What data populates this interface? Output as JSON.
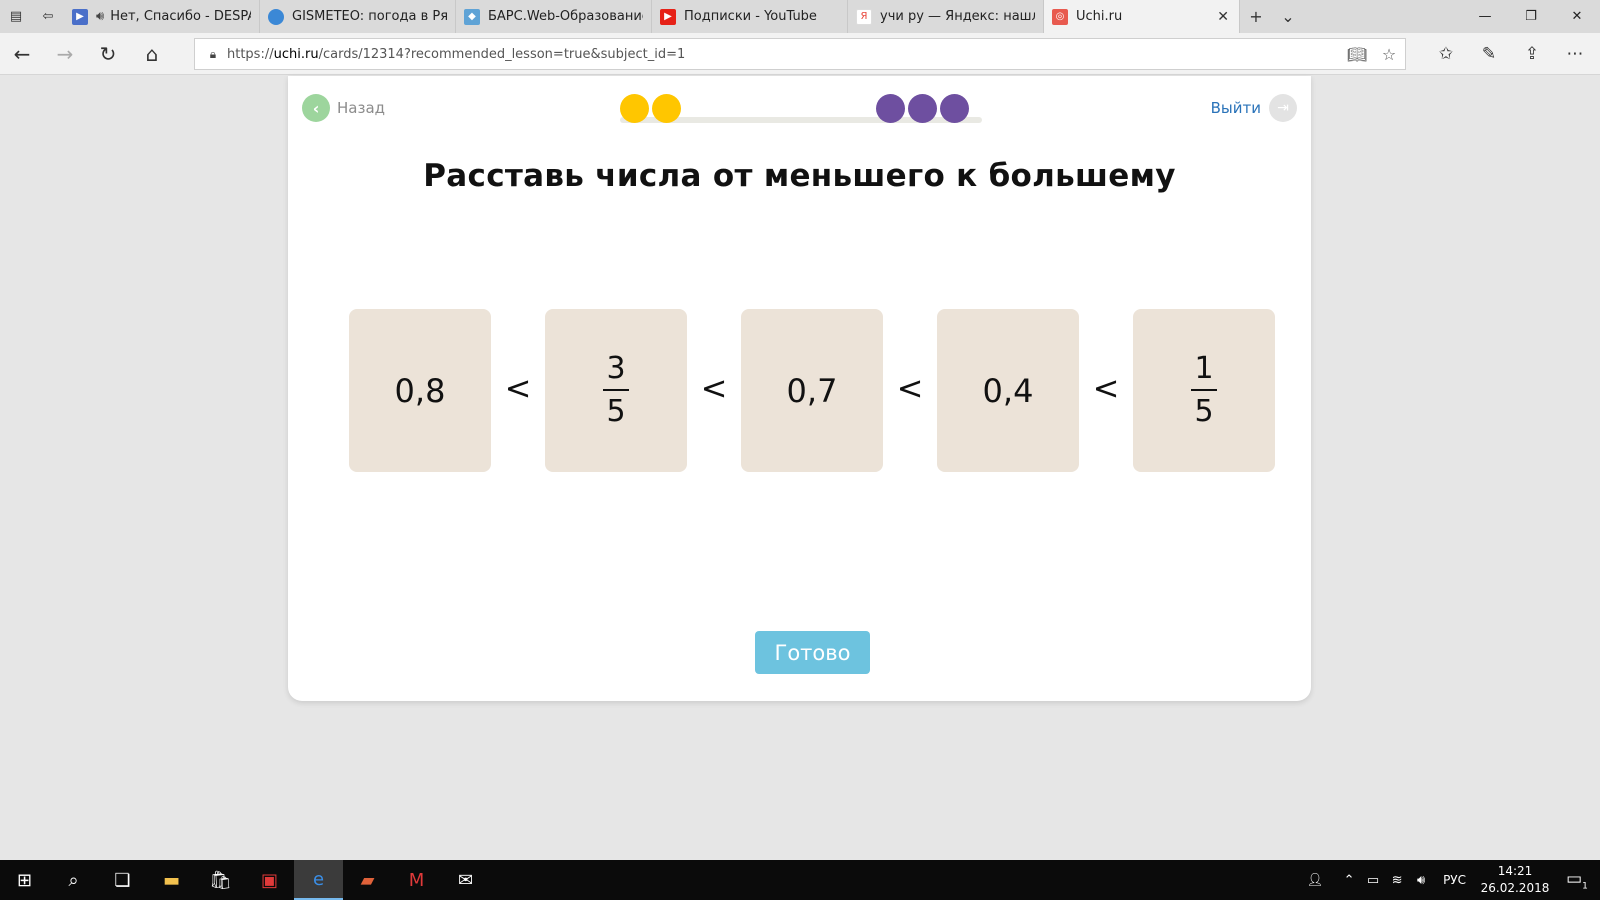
{
  "browser": {
    "tabs": [
      {
        "title": "Нет, Спасибо - DESPAC",
        "favicon": "media-player-icon",
        "favicon_color": "#4a6fc9",
        "extra": "speaker"
      },
      {
        "title": "GISMETEO: погода в Рязан",
        "favicon": "droplet-icon",
        "favicon_color": "#3b88d6"
      },
      {
        "title": "БАРС.Web-Образование",
        "favicon": "bars-icon",
        "favicon_color": "#5fa3d6"
      },
      {
        "title": "Подписки - YouTube",
        "favicon": "youtube-icon",
        "favicon_color": "#e62117"
      },
      {
        "title": "учи ру — Яндекс: нашлось",
        "favicon": "yandex-icon",
        "favicon_color": "#e8463b"
      },
      {
        "title": "Uchi.ru",
        "favicon": "uchi-icon",
        "favicon_color": "#e85a4f",
        "active": true
      }
    ],
    "address": {
      "scheme_prefix": "https://",
      "host": "uchi.ru",
      "path": "/cards/12314?recommended_lesson=true&subject_id=1"
    }
  },
  "lesson": {
    "back_label": "Назад",
    "exit_label": "Выйти",
    "progress": {
      "completed": 2,
      "remaining": 3,
      "completed_color": "#ffc600",
      "remaining_color": "#6e4fa0"
    },
    "title": "Расставь числа от меньшего к большему",
    "comparison_sign": "<",
    "tiles": [
      {
        "type": "decimal",
        "text": "0,8"
      },
      {
        "type": "fraction",
        "numerator": "3",
        "denominator": "5"
      },
      {
        "type": "decimal",
        "text": "0,7"
      },
      {
        "type": "decimal",
        "text": "0,4"
      },
      {
        "type": "fraction",
        "numerator": "1",
        "denominator": "5"
      }
    ],
    "done_label": "Готово"
  },
  "taskbar": {
    "language": "РУС",
    "time": "14:21",
    "date": "26.02.2018",
    "notifications": "1"
  },
  "colors": {
    "tile_bg": "#ece3d8",
    "done_button": "#6dc3df",
    "back_circle": "#9dd59d",
    "exit_link": "#2a73b9"
  }
}
